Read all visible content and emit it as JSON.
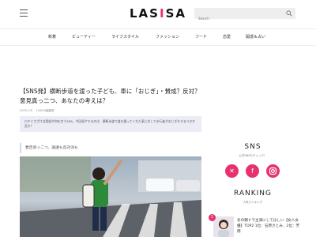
{
  "header": {
    "logo_prefix": "LAS",
    "logo_dot": "I",
    "logo_suffix": "SA",
    "search_placeholder": "Search",
    "brand_color": "#e6326e"
  },
  "nav": {
    "items": [
      "新着",
      "ビューティー",
      "ライフスタイル",
      "ファッション",
      "フード",
      "恋愛",
      "開運＆占い"
    ]
  },
  "article": {
    "title": "【SNS発】横断歩道を渡った子ども、車に「おじぎ」・賛成？反対？　意見真っ二つ、あなたの考えは？",
    "date": "2025.2.8",
    "author": "LASISA編集部",
    "lead": "ロキとさざけば登録が何を言うSNS。今回紹介するのは、横断歩道で道を譲ってくれた車に対して歩行者がおじぎをするべきか否か？",
    "caption": "賛否真っ二つ、論議も反対派も"
  },
  "sidebar": {
    "sns_title": "SNS",
    "sns_sub": "公式SNSもチェック！",
    "sns_icons": [
      "x-icon",
      "facebook-icon",
      "instagram-icon"
    ],
    "ranking_title": "RANKING",
    "ranking_sub": "人気ランキング",
    "ranking_items": [
      {
        "rank": "1",
        "text": "冬の朝ドラ主演にしてほしい【女人女優】TOP2 1位：石原さとみ、2位：芳雨"
      }
    ]
  }
}
